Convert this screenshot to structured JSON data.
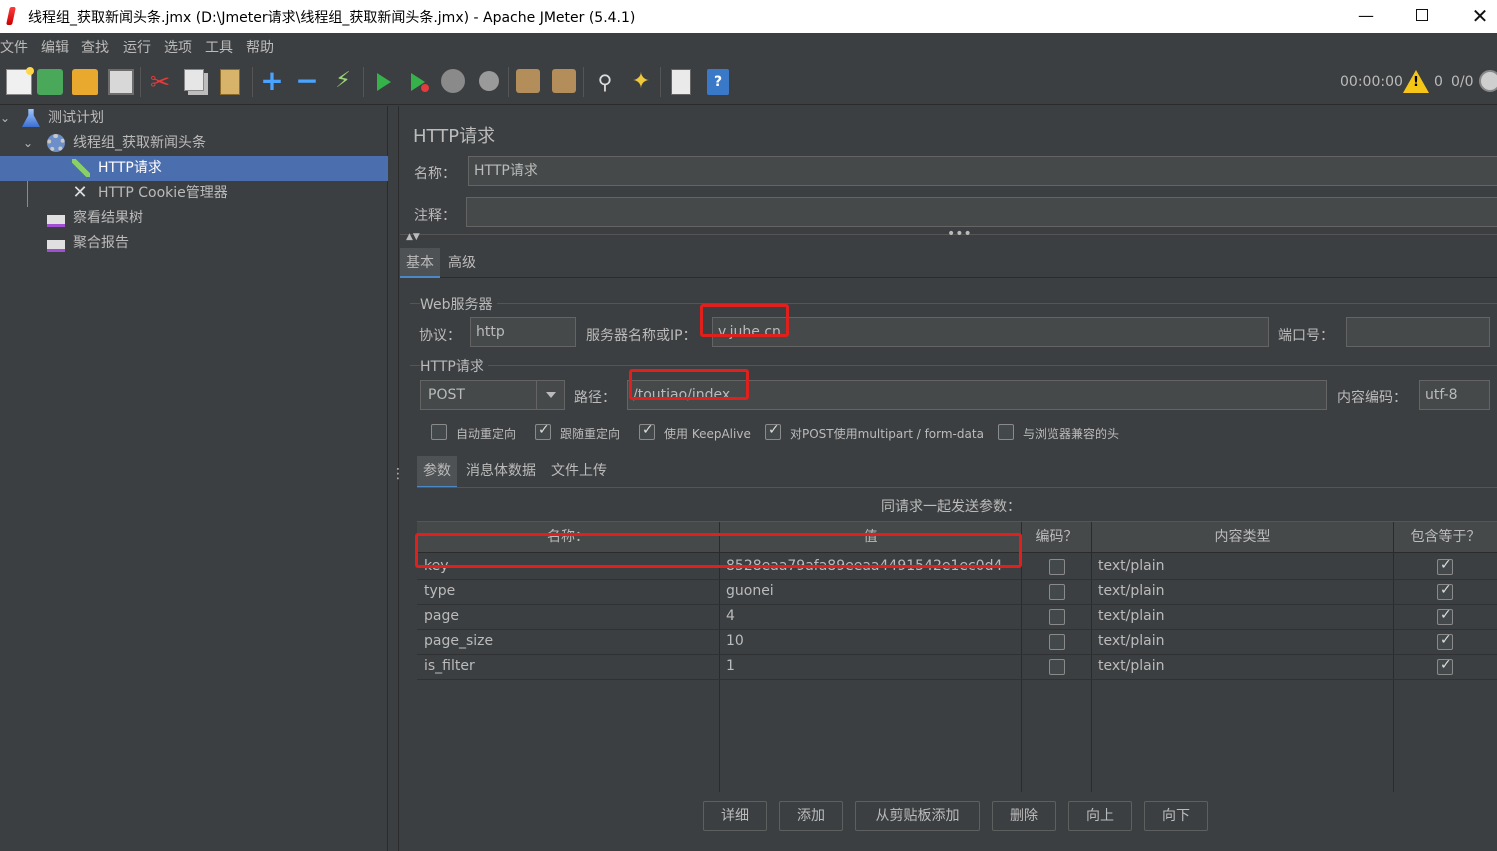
{
  "window": {
    "title": "线程组_获取新闻头条.jmx (D:\\Jmeter请求\\线程组_获取新闻头条.jmx) - Apache JMeter (5.4.1)",
    "minimize": "—",
    "close": "✕"
  },
  "menu": [
    "文件",
    "编辑",
    "查找",
    "运行",
    "选项",
    "工具",
    "帮助"
  ],
  "toolbar": {
    "timer": "00:00:00",
    "warn_glyph": "!",
    "error_count": "0",
    "threads": "0/0",
    "icons": [
      "new-icon",
      "templates-icon",
      "open-icon",
      "save-icon",
      "cut-icon",
      "copy-icon",
      "paste-icon",
      "expand-icon",
      "collapse-icon",
      "toggle-icon",
      "start-icon",
      "start-no-pause-icon",
      "stop-icon",
      "shutdown-icon",
      "clear-icon",
      "clear-all-icon",
      "search-icon",
      "reset-search-icon",
      "function-helper-icon",
      "help-icon"
    ]
  },
  "tree": {
    "items": [
      {
        "label": "测试计划",
        "toggle": "⌄"
      },
      {
        "label": "线程组_获取新闻头条",
        "toggle": "⌄"
      },
      {
        "label": "HTTP请求"
      },
      {
        "label": "HTTP Cookie管理器"
      },
      {
        "label": "察看结果树"
      },
      {
        "label": "聚合报告"
      }
    ]
  },
  "sampler": {
    "heading": "HTTP请求",
    "name_label": "名称：",
    "name_value": "HTTP请求",
    "comment_label": "注释：",
    "comment_value": "",
    "collapse_arrows": "▲▼",
    "collapse_dots": "•••",
    "tabs": [
      "基本",
      "高级"
    ],
    "web_server": {
      "group_title": "Web服务器",
      "protocol_label": "协议：",
      "protocol_value": "http",
      "server_label": "服务器名称或IP：",
      "server_value": "v.juhe.cn",
      "port_label": "端口号：",
      "port_value": ""
    },
    "http_request": {
      "group_title": "HTTP请求",
      "method": "POST",
      "path_label": "路径：",
      "path_value": "/toutiao/index",
      "encoding_label": "内容编码：",
      "encoding_value": "utf-8"
    },
    "options": [
      {
        "label": "自动重定向",
        "checked": false
      },
      {
        "label": "跟随重定向",
        "checked": true
      },
      {
        "label": "使用 KeepAlive",
        "checked": true
      },
      {
        "label": "对POST使用multipart / form-data",
        "checked": true
      },
      {
        "label": "与浏览器兼容的头",
        "checked": false
      }
    ],
    "sub_tabs": [
      "参数",
      "消息体数据",
      "文件上传"
    ],
    "params_title": "同请求一起发送参数：",
    "columns": [
      "名称：",
      "值",
      "编码？",
      "内容类型",
      "包含等于？"
    ],
    "rows": [
      {
        "name": "key",
        "value": "8528eaa79afa89eeaa4491542e1ec0d4",
        "encode": false,
        "content_type": "text/plain",
        "include_equals": true
      },
      {
        "name": "type",
        "value": "guonei",
        "encode": false,
        "content_type": "text/plain",
        "include_equals": true
      },
      {
        "name": "page",
        "value": "4",
        "encode": false,
        "content_type": "text/plain",
        "include_equals": true
      },
      {
        "name": "page_size",
        "value": "10",
        "encode": false,
        "content_type": "text/plain",
        "include_equals": true
      },
      {
        "name": "is_filter",
        "value": "1",
        "encode": false,
        "content_type": "text/plain",
        "include_equals": true
      }
    ],
    "buttons": [
      "详细",
      "添加",
      "从剪贴板添加",
      "删除",
      "向上",
      "向下"
    ]
  },
  "annotation_color": "#e0201c"
}
